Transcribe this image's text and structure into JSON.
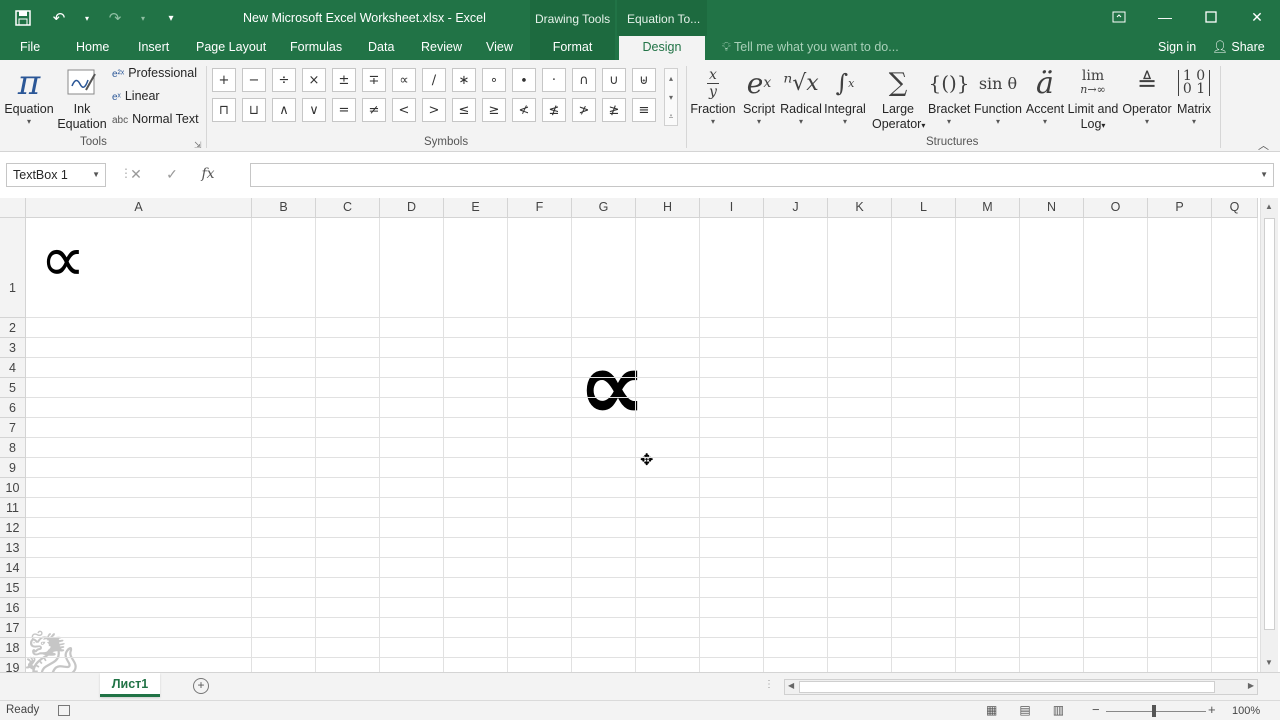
{
  "window": {
    "title": "New Microsoft Excel Worksheet.xlsx - Excel",
    "context_drawing": "Drawing Tools",
    "context_equation": "Equation To...",
    "min_icon": "minimize-icon",
    "restore_icon": "restore-icon",
    "close_icon": "close-icon"
  },
  "tabs": {
    "file": "File",
    "home": "Home",
    "insert": "Insert",
    "page_layout": "Page Layout",
    "formulas": "Formulas",
    "data": "Data",
    "review": "Review",
    "view": "View",
    "format": "Format",
    "design": "Design",
    "tell_me": "Tell me what you want to do...",
    "sign_in": "Sign in",
    "share": "Share"
  },
  "ribbon": {
    "tools": {
      "equation_l1": "Equation",
      "ink_l1": "Ink",
      "ink_l2": "Equation",
      "professional": "Professional",
      "linear": "Linear",
      "normal_text": "Normal Text",
      "normal_text_prefix": "abc",
      "label": "Tools"
    },
    "symbols": {
      "label": "Symbols",
      "items": [
        "+",
        "−",
        "÷",
        "×",
        "±",
        "∓",
        "∝",
        "∕",
        "∗",
        "∘",
        "∙",
        "·",
        "∩",
        "∪",
        "⊎",
        "⊓",
        "⊔",
        "∧",
        "∨",
        "=",
        "≠",
        "<",
        ">",
        "≤",
        "≥",
        "≮",
        "≰",
        "≯",
        "≱",
        "≡"
      ]
    },
    "structures": {
      "label": "Structures",
      "fraction": "Fraction",
      "script": "Script",
      "radical": "Radical",
      "integral": "Integral",
      "large_l1": "Large",
      "large_l2": "Operator",
      "bracket": "Bracket",
      "function": "Function",
      "accent": "Accent",
      "limit_l1": "Limit and",
      "limit_l2": "Log",
      "operator": "Operator",
      "matrix": "Matrix"
    }
  },
  "formula_bar": {
    "name_box": "TextBox 1",
    "fx": "fx",
    "value": ""
  },
  "grid": {
    "columns": [
      "A",
      "B",
      "C",
      "D",
      "E",
      "F",
      "G",
      "H",
      "I",
      "J",
      "K",
      "L",
      "M",
      "N",
      "O",
      "P",
      "Q"
    ],
    "rows": [
      "1",
      "2",
      "3",
      "4",
      "5",
      "6",
      "7",
      "8",
      "9",
      "10",
      "11",
      "12",
      "13",
      "14",
      "15",
      "16",
      "17",
      "18",
      "19"
    ],
    "equation_small": "∝",
    "equation_large": "∝"
  },
  "sheets": {
    "active": "Лист1"
  },
  "status": {
    "ready": "Ready",
    "zoom": "100%"
  },
  "colors": {
    "excel_green": "#217346",
    "ribbon_bg": "#f3f3f3"
  }
}
